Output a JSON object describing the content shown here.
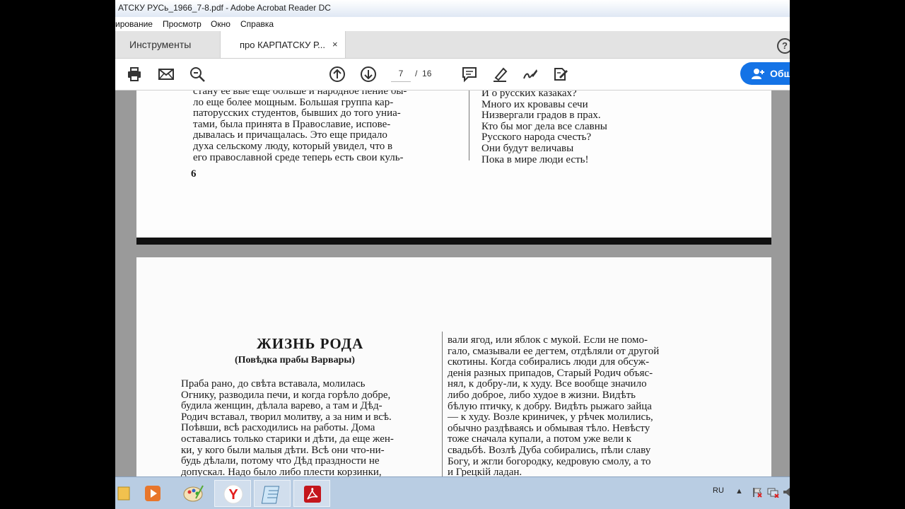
{
  "window": {
    "title": "АТСКУ РУСь_1966_7-8.pdf - Adobe Acrobat Reader DC"
  },
  "menu": {
    "items": [
      "ирование",
      "Просмотр",
      "Окно",
      "Справка"
    ]
  },
  "tabs": {
    "tools_label": "Инструменты",
    "doc_label": "про КАРПАТСКУ Р...",
    "close_glyph": "×",
    "help_glyph": "?"
  },
  "toolbar": {
    "icons": [
      "printer-icon",
      "mail-icon",
      "zoom-search-icon",
      "page-up-icon",
      "page-down-icon",
      "comment-icon",
      "highlight-pen-icon",
      "sign-icon",
      "fill-sign-icon"
    ],
    "current_page": "7",
    "page_separator": "/",
    "total_pages": "16",
    "share_label": "Обш"
  },
  "page1": {
    "left_lines": [
      "стану ее вые еще больше и народное пение бы-",
      "ло еще более мощным. Большая группа кар-",
      "паторусских студентов, бывших до того униа-",
      "тами, была принята в Православие, испове-",
      "дывалась и причащалась. Это еще придало",
      "духа сельскому люду, который увидел, что в",
      "его православной среде теперь есть свои куль-"
    ],
    "page_number": "6",
    "right_lines": [
      "И о русских казаках?",
      "Много их кровавы сечи",
      "Низвергали градов в прах.",
      "Кто бы мог дела все славны",
      "Русского народа счесть?",
      "Они будут величавы",
      "Пока в мире люди есть!"
    ]
  },
  "page2": {
    "title": "ЖИЗНЬ РОДА",
    "subtitle": "(Повѣдка прабы Варвары)",
    "left_lines": [
      "Праба рано, до свѣта вставала, молилась",
      "Огнику, разводила печи, и когда горѣло добре,",
      "будила женщин, дѣлала варево, а там и Дѣд-",
      "Родич вставал, творил молитву, а за ним и всѣ.",
      "Поѣвши, всѣ расходились на работы. Дома",
      "оставались только старики и дѣти, да еще жен-",
      "ки, у кого были малыя дѣти. Всѣ они что-ни-",
      "будь дѣлали, потому что Дѣд праздности не",
      "допускал. Надо было либо плести корзинки,"
    ],
    "right_lines": [
      "вали ягод, или яблок с мукой. Если не помо-",
      "гало, смазывали ее дегтем, отдѣляли от другой",
      "скотины. Когда собирались люди для обсуж-",
      "денія разных припадов, Старый Родич объяс-",
      "нял, к добру-ли, к худу. Все вообще значило",
      "либо доброе, либо худое в жизни. Видѣть",
      "бѣлую птичку, к добру. Видѣть рыжаго зайца",
      "— к худу. Возле криничек, у рѣчек молились,",
      "обычно раздѣваясь и обмывая тѣло. Невѣсту",
      "тоже сначала купали, а потом уже вели к",
      "свадьбѣ. Возлѣ Дуба собирались, пѣли славу",
      "Богу, и жгли богородку, кедровую смолу, а то",
      "и Грецкій ладан."
    ]
  },
  "taskbar": {
    "apps": [
      "explorer-icon",
      "media-player-icon",
      "paint-icon",
      "yandex-browser-icon",
      "notepad-icon",
      "acrobat-icon"
    ],
    "language": "RU",
    "tray_arrow": "▲"
  },
  "colors": {
    "accent": "#1473e6",
    "taskbar": "#b9cde3",
    "viewer_bg": "#9a9a9a"
  }
}
